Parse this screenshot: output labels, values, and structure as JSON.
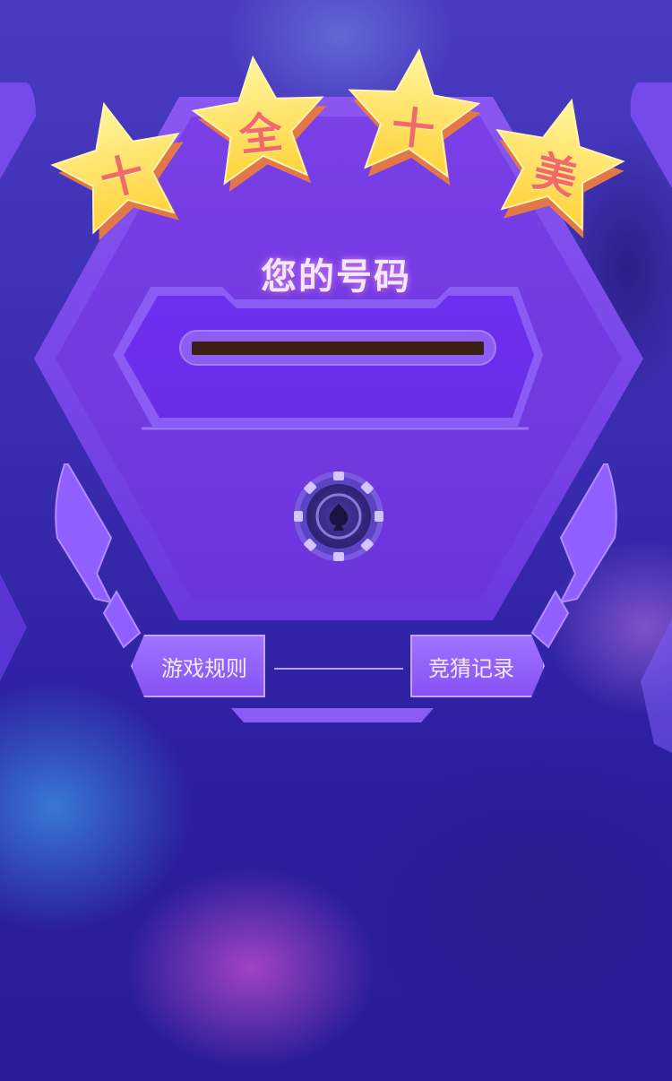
{
  "banner": {
    "stars": [
      "十",
      "全",
      "十",
      "美"
    ]
  },
  "panel": {
    "title": "您的号码",
    "number_value": ""
  },
  "buttons": {
    "rules": "游戏规则",
    "records": "竞猜记录"
  },
  "colors": {
    "panel_purple": "#7a45ea",
    "star_yellow": "#ffe36a",
    "number_bar": "#3b1f14"
  },
  "icons": {
    "center": "poker-chip-spade-icon"
  }
}
